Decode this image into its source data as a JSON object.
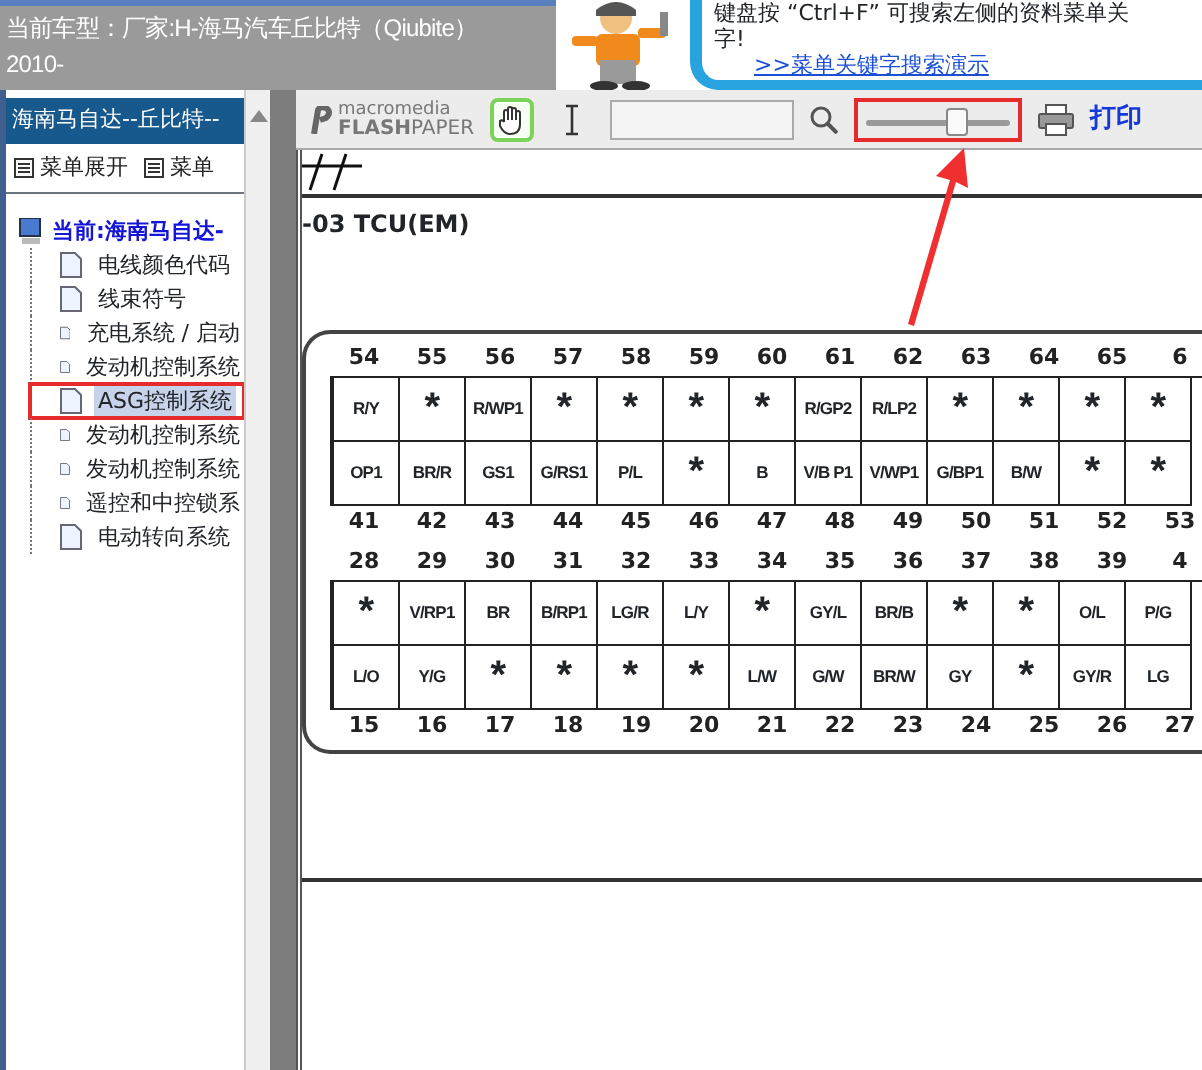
{
  "header": {
    "title": "当前车型：厂家:H-海马汽车丘比特（Qiubite）",
    "subtitle": "2010-",
    "tip_lines": [
      "键盘按 “Ctrl+F” 可搜索左侧的资料菜单关",
      "字!"
    ],
    "demo_link": ">>菜单关键字搜索演示"
  },
  "sidebar": {
    "title": "海南马自达--丘比特--",
    "buttons": [
      "菜单展开",
      "菜单"
    ],
    "root": "当前:海南马自达-",
    "items": [
      {
        "label": "电线颜色代码",
        "selected": false,
        "highlighted": false
      },
      {
        "label": "线束符号",
        "selected": false,
        "highlighted": false
      },
      {
        "label": "充电系统 / 启动",
        "selected": false,
        "highlighted": false
      },
      {
        "label": "发动机控制系统",
        "selected": false,
        "highlighted": false
      },
      {
        "label": "ASG控制系统",
        "selected": true,
        "highlighted": true
      },
      {
        "label": "发动机控制系统",
        "selected": false,
        "highlighted": false
      },
      {
        "label": "发动机控制系统",
        "selected": false,
        "highlighted": false
      },
      {
        "label": "遥控和中控锁系",
        "selected": false,
        "highlighted": false
      },
      {
        "label": "电动转向系统",
        "selected": false,
        "highlighted": false
      }
    ]
  },
  "toolbar": {
    "logo_top": "macromedia",
    "logo_bottom": "**FLASH**PAPER",
    "tools": [
      {
        "kind": "hand",
        "selected": true
      },
      {
        "kind": "text",
        "selected": false
      }
    ],
    "zoom": {
      "level": 0.62,
      "highlighted": true
    },
    "print_label": "打印"
  },
  "document": {
    "heading": "-03 TCU(EM)",
    "connectors": [
      {
        "top_pins": [
          "54",
          "55",
          "56",
          "57",
          "58",
          "59",
          "60",
          "61",
          "62",
          "63",
          "64",
          "65",
          "6"
        ],
        "top_cells": [
          "R/Y",
          "*",
          "R/WP1",
          "*",
          "*",
          "*",
          "*",
          "R/GP2",
          "R/LP2",
          "*",
          "*",
          "*",
          "*"
        ],
        "bottom_cells": [
          "OP1",
          "BR/R",
          "GS1",
          "G/RS1",
          "P/L",
          "*",
          "B",
          "V/B P1",
          "V/WP1",
          "G/BP1",
          "B/W",
          "*",
          "*"
        ],
        "bottom_pins": [
          "41",
          "42",
          "43",
          "44",
          "45",
          "46",
          "47",
          "48",
          "49",
          "50",
          "51",
          "52",
          "53"
        ]
      },
      {
        "top_pins": [
          "28",
          "29",
          "30",
          "31",
          "32",
          "33",
          "34",
          "35",
          "36",
          "37",
          "38",
          "39",
          "4"
        ],
        "top_cells": [
          "*",
          "V/RP1",
          "BR",
          "B/RP1",
          "LG/R",
          "L/Y",
          "*",
          "GY/L",
          "BR/B",
          "*",
          "*",
          "O/L",
          "P/G"
        ],
        "bottom_cells": [
          "L/O",
          "Y/G",
          "*",
          "*",
          "*",
          "*",
          "L/W",
          "G/W",
          "BR/W",
          "GY",
          "*",
          "GY/R",
          "LG"
        ],
        "bottom_pins": [
          "15",
          "16",
          "17",
          "18",
          "19",
          "20",
          "21",
          "22",
          "23",
          "24",
          "25",
          "26",
          "27"
        ]
      }
    ]
  }
}
